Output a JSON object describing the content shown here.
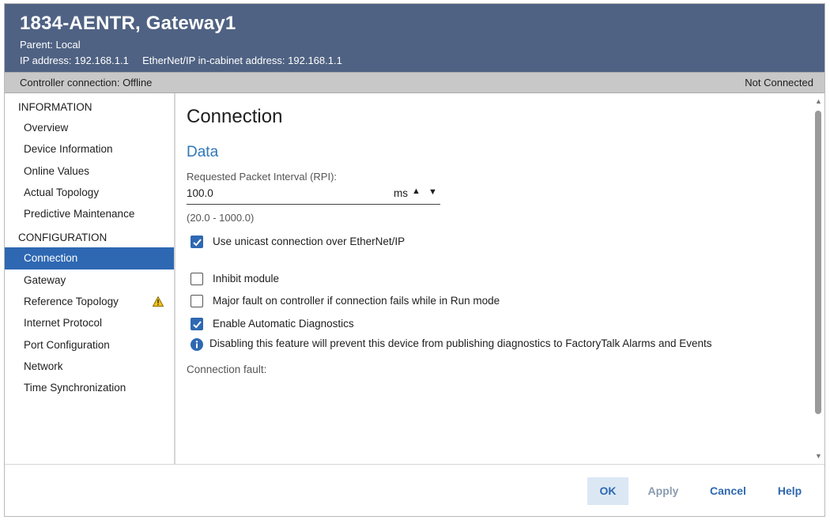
{
  "header": {
    "title": "1834-AENTR, Gateway1",
    "parent_label": "Parent:",
    "parent_value": "Local",
    "ip_label": "IP address:",
    "ip_value": "192.168.1.1",
    "incab_label": "EtherNet/IP in-cabinet address:",
    "incab_value": "192.168.1.1",
    "bg_color": "#4f6283"
  },
  "status": {
    "controller_connection": "Controller connection: Offline",
    "connection_state": "Not Connected"
  },
  "sidebar": {
    "sections": [
      {
        "title": "INFORMATION",
        "items": [
          {
            "label": "Overview"
          },
          {
            "label": "Device Information"
          },
          {
            "label": "Online Values"
          },
          {
            "label": "Actual Topology"
          },
          {
            "label": "Predictive Maintenance"
          }
        ]
      },
      {
        "title": "CONFIGURATION",
        "items": [
          {
            "label": "Connection",
            "active": true
          },
          {
            "label": "Gateway"
          },
          {
            "label": "Reference Topology",
            "icon": "warning-icon"
          },
          {
            "label": "Internet Protocol"
          },
          {
            "label": "Port Configuration"
          },
          {
            "label": "Network"
          },
          {
            "label": "Time Synchronization"
          }
        ]
      }
    ],
    "active_color": "#2e68b2"
  },
  "main": {
    "title": "Connection",
    "section": "Data",
    "rpi": {
      "label": "Requested Packet Interval (RPI):",
      "value": "100.0",
      "unit": "ms",
      "range": "(20.0 - 1000.0)"
    },
    "options": {
      "unicast": {
        "label": "Use unicast connection over EtherNet/IP",
        "checked": true
      },
      "inhibit": {
        "label": "Inhibit module",
        "checked": false
      },
      "major_fault": {
        "label": "Major fault on controller if connection fails while in Run mode",
        "checked": false
      },
      "auto_diag": {
        "label": "Enable Automatic Diagnostics",
        "checked": true
      }
    },
    "info_text": "Disabling this feature will prevent this device from publishing diagnostics to FactoryTalk Alarms and Events",
    "connection_fault_label": "Connection fault:"
  },
  "footer": {
    "ok": "OK",
    "apply": "Apply",
    "cancel": "Cancel",
    "help": "Help"
  }
}
